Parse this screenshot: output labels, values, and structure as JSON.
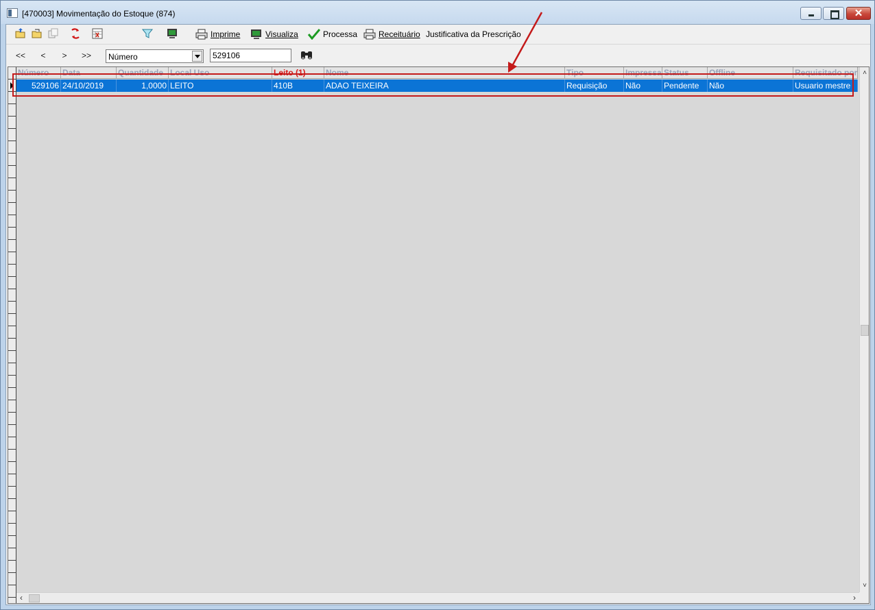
{
  "window": {
    "title": "[470003]  Movimentação do Estoque (874)",
    "close_glyph": "✕"
  },
  "toolbar": {
    "icons": [
      "open-folder-icon",
      "open-folder-alt-icon",
      "copy-icon",
      "refresh-icon",
      "calendar-grid-icon",
      "filter-icon",
      "monitor-icon"
    ],
    "imprime_label": "Imprime",
    "visualiza_label": "Visualiza",
    "processa_label": "Processa",
    "receituario_label": "Receituário",
    "justificativa_label": "Justificativa da Prescrição"
  },
  "navigation": {
    "first": "<<",
    "prev": "<",
    "next": ">",
    "last": ">>",
    "field_select_value": "Número",
    "search_value": "529106"
  },
  "grid": {
    "columns": [
      "Número",
      "Data",
      "Quantidade",
      "Local Uso",
      "Leito (1)",
      "Nome",
      "Tipo",
      "Impressa",
      "Status",
      "Offline",
      "Requisitado por"
    ],
    "sorted_column": "Leito (1)",
    "rows": [
      {
        "numero": "529106",
        "data": "24/10/2019",
        "quantidade": "1,0000",
        "local_uso": "LEITO",
        "leito": "410B",
        "nome": "ADAO TEIXEIRA",
        "tipo": "Requisição",
        "impressa": "Não",
        "status": "Pendente",
        "offline": "Não",
        "requisitado_por": "Usuario mestre"
      }
    ]
  },
  "scrollbars": {
    "up": "˄",
    "down": "˅",
    "left": "‹",
    "right": "›"
  },
  "colors": {
    "selection": "#0b74d6",
    "annotation": "#c41a1a",
    "sorted_header": "#d81818"
  }
}
